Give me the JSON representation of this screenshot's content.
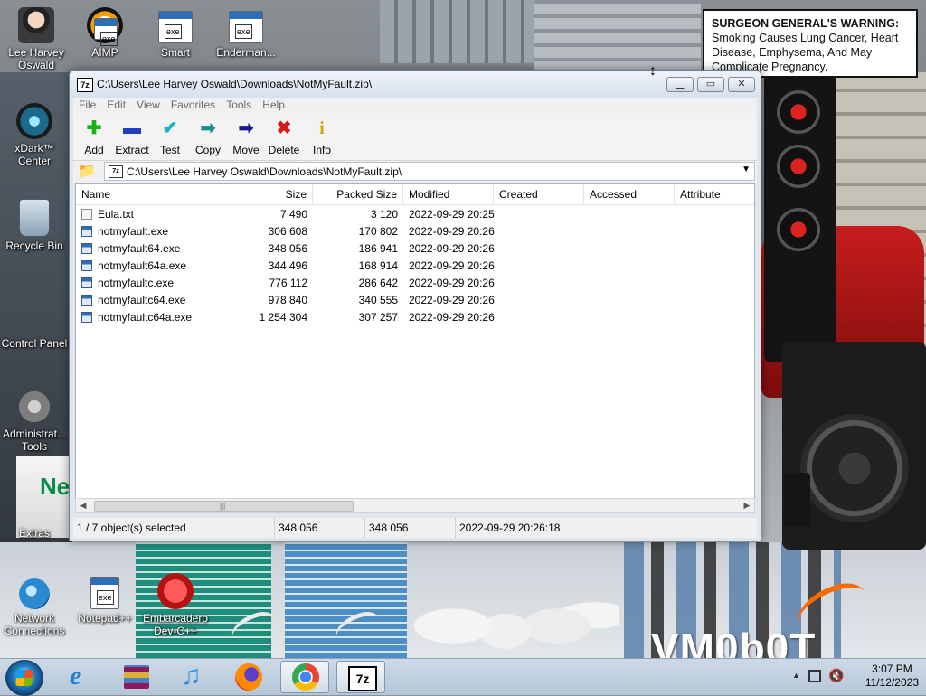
{
  "desktop": {
    "icons": [
      {
        "label": "Lee Harvey\nOswald"
      },
      {
        "label": "AIMP"
      },
      {
        "label": "Smart"
      },
      {
        "label": "Enderman..."
      },
      {
        "label": "xDark™\nCenter"
      },
      {
        "label": "Recycle Bin"
      },
      {
        "label": "Control Panel"
      },
      {
        "label": "Administrat...\nTools"
      },
      {
        "label": "Extras"
      },
      {
        "label": "Network\nConnections"
      },
      {
        "label": "Notepad++"
      },
      {
        "label": "Embarcadero\nDev-C++"
      }
    ],
    "warning": {
      "bold": "SURGEON GENERAL'S WARNING:",
      "text": " Smoking Causes Lung Cancer, Heart Disease, Emphysema, And May Complicate Pregnancy."
    },
    "wallpaper_text": "VM0b0T",
    "netbox_text": "Ne"
  },
  "window": {
    "icon_text": "7z",
    "title": "C:\\Users\\Lee Harvey Oswald\\Downloads\\NotMyFault.zip\\",
    "controls": {
      "minimize": "▁",
      "maximize": "▭",
      "close": "✕"
    },
    "menu": [
      "File",
      "Edit",
      "View",
      "Favorites",
      "Tools",
      "Help"
    ],
    "toolbar": [
      {
        "label": "Add",
        "icon": "plus-icon",
        "glyph": "✚",
        "color": "#1bb31b"
      },
      {
        "label": "Extract",
        "icon": "minus-icon",
        "glyph": "▬",
        "color": "#1f3fbf"
      },
      {
        "label": "Test",
        "icon": "check-icon",
        "glyph": "✔",
        "color": "#16b3c4"
      },
      {
        "label": "Copy",
        "icon": "copy-arrow-icon",
        "glyph": "➡",
        "color": "#1a8f8a"
      },
      {
        "label": "Move",
        "icon": "move-arrow-icon",
        "glyph": "➡",
        "color": "#1a1a8f"
      },
      {
        "label": "Delete",
        "icon": "delete-x-icon",
        "glyph": "✖",
        "color": "#d61a1a"
      },
      {
        "label": "Info",
        "icon": "info-icon",
        "glyph": "i",
        "color": "#d4a600"
      }
    ],
    "address": {
      "icon_text": "7z",
      "path": "C:\\Users\\Lee Harvey Oswald\\Downloads\\NotMyFault.zip\\",
      "dropdown": "▼"
    },
    "columns": [
      "Name",
      "Size",
      "Packed Size",
      "Modified",
      "Created",
      "Accessed",
      "Attribute"
    ],
    "files": [
      {
        "name": "Eula.txt",
        "size": "7 490",
        "packed": "3 120",
        "modified": "2022-09-29 20:25",
        "type": "txt"
      },
      {
        "name": "notmyfault.exe",
        "size": "306 608",
        "packed": "170 802",
        "modified": "2022-09-29 20:26",
        "type": "exe"
      },
      {
        "name": "notmyfault64.exe",
        "size": "348 056",
        "packed": "186 941",
        "modified": "2022-09-29 20:26",
        "type": "exe"
      },
      {
        "name": "notmyfault64a.exe",
        "size": "344 496",
        "packed": "168 914",
        "modified": "2022-09-29 20:26",
        "type": "exe"
      },
      {
        "name": "notmyfaultc.exe",
        "size": "776 112",
        "packed": "286 642",
        "modified": "2022-09-29 20:26",
        "type": "exe"
      },
      {
        "name": "notmyfaultc64.exe",
        "size": "978 840",
        "packed": "340 555",
        "modified": "2022-09-29 20:26",
        "type": "exe"
      },
      {
        "name": "notmyfaultc64a.exe",
        "size": "1 254 304",
        "packed": "307 257",
        "modified": "2022-09-29 20:26",
        "type": "exe"
      }
    ],
    "scroll": {
      "left": "◀",
      "right": "▶",
      "grip": "|||"
    },
    "status": {
      "selection": "1 / 7 object(s) selected",
      "size": "348 056",
      "packed": "348 056",
      "modified": "2022-09-29 20:26:18"
    }
  },
  "taskbar": {
    "pinned": [
      "Internet Explorer",
      "WinRAR",
      "iTunes",
      "Firefox",
      "Chrome",
      "7-Zip"
    ],
    "ie_glyph": "e",
    "music_glyph": "♫",
    "sevenzip_text": "7z",
    "tray": {
      "time": "3:07 PM",
      "date": "11/12/2023",
      "show_hidden": "▲"
    }
  }
}
